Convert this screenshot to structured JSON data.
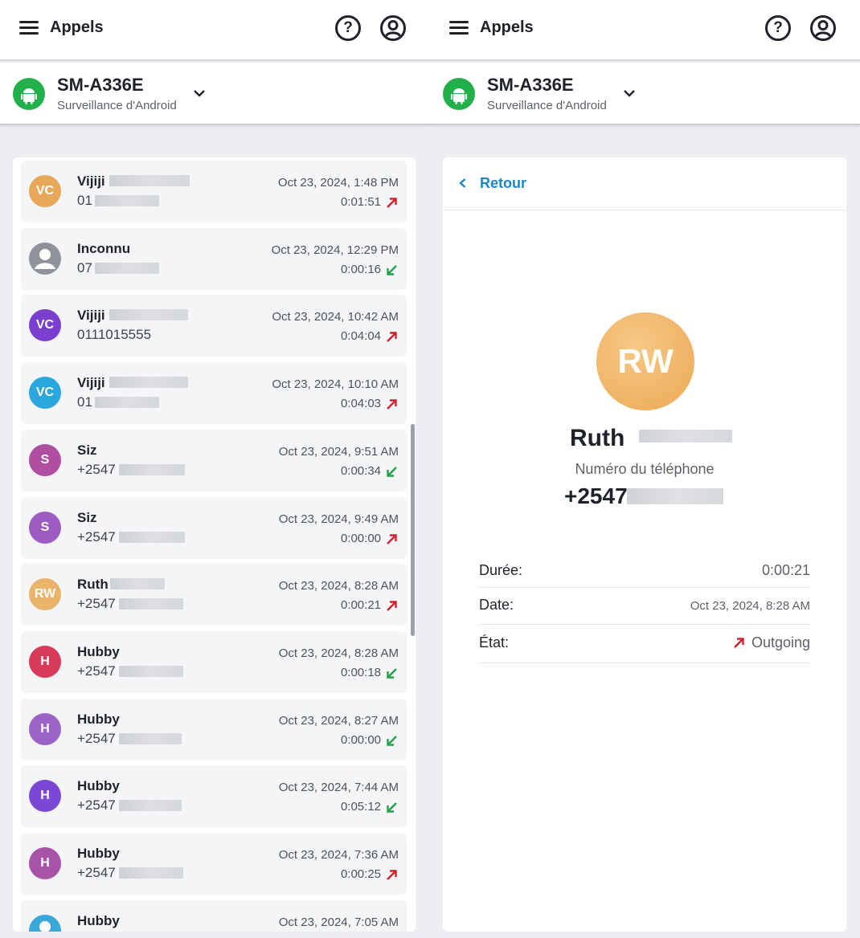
{
  "app": {
    "title": "Appels"
  },
  "device": {
    "name": "SM-A336E",
    "subtitle": "Surveillance d'Android"
  },
  "icons": {
    "menu": "hamburger-menu-icon",
    "help": "question-mark-icon",
    "account": "user-circle-icon",
    "device": "android-icon",
    "dropdown": "chevron-down-icon",
    "outgoing": "arrow-up-right-icon",
    "incoming": "arrow-down-left-icon",
    "back": "chevron-left-icon"
  },
  "colors": {
    "outgoing": "#d0202e",
    "incoming": "#22a04b",
    "link": "#1a86c7",
    "android_green": "#22b04b"
  },
  "help_glyph": "?",
  "calls": [
    {
      "initials": "VC",
      "avatar_color": "#e8a85a",
      "name": "Vijiji",
      "number": "01",
      "date": "Oct 23, 2024, 1:48 PM",
      "duration": "0:01:51",
      "direction": "outgoing"
    },
    {
      "initials": "",
      "avatar_color": "#8e939b",
      "name": "Inconnu",
      "number": "07",
      "date": "Oct 23, 2024, 12:29 PM",
      "duration": "0:00:16",
      "direction": "incoming"
    },
    {
      "initials": "VC",
      "avatar_color": "#7a3fd1",
      "name": "Vijiji",
      "number": "0111015555",
      "date": "Oct 23, 2024, 10:42 AM",
      "duration": "0:04:04",
      "direction": "outgoing"
    },
    {
      "initials": "VC",
      "avatar_color": "#2aa7dd",
      "name": "Vijiji",
      "number": "01",
      "date": "Oct 23, 2024, 10:10 AM",
      "duration": "0:04:03",
      "direction": "outgoing"
    },
    {
      "initials": "S",
      "avatar_color": "#b04fa0",
      "name": "Siz",
      "number": "+2547",
      "date": "Oct 23, 2024, 9:51 AM",
      "duration": "0:00:34",
      "direction": "incoming"
    },
    {
      "initials": "S",
      "avatar_color": "#9c5cc0",
      "name": "Siz",
      "number": "+2547",
      "date": "Oct 23, 2024, 9:49 AM",
      "duration": "0:00:00",
      "direction": "outgoing"
    },
    {
      "initials": "RW",
      "avatar_color": "#eab46a",
      "name": "Ruth",
      "number": "+2547",
      "date": "Oct 23, 2024, 8:28 AM",
      "duration": "0:00:21",
      "direction": "outgoing"
    },
    {
      "initials": "H",
      "avatar_color": "#d83a5a",
      "name": "Hubby",
      "number": "+2547",
      "date": "Oct 23, 2024, 8:28 AM",
      "duration": "0:00:18",
      "direction": "incoming"
    },
    {
      "initials": "H",
      "avatar_color": "#9a63c6",
      "name": "Hubby",
      "number": "+2547",
      "date": "Oct 23, 2024, 8:27 AM",
      "duration": "0:00:00",
      "direction": "incoming"
    },
    {
      "initials": "H",
      "avatar_color": "#7b48d6",
      "name": "Hubby",
      "number": "+2547",
      "date": "Oct 23, 2024, 7:44 AM",
      "duration": "0:05:12",
      "direction": "incoming"
    },
    {
      "initials": "H",
      "avatar_color": "#a653a8",
      "name": "Hubby",
      "number": "+2547",
      "date": "Oct 23, 2024, 7:36 AM",
      "duration": "0:00:25",
      "direction": "outgoing"
    },
    {
      "initials": "",
      "avatar_color": "#3aa8d8",
      "name": "Hubby",
      "number": "",
      "date": "Oct 23, 2024, 7:05 AM",
      "duration": "",
      "direction": ""
    }
  ],
  "detail": {
    "back_label": "Retour",
    "initials": "RW",
    "name": "Ruth",
    "phone_label": "Numéro du téléphone",
    "phone": "+2547",
    "fields": [
      {
        "label": "Durée:",
        "value": "0:00:21"
      },
      {
        "label": "Date:",
        "value": "Oct 23, 2024, 8:28 AM"
      },
      {
        "label": "État:",
        "value": "Outgoing",
        "direction": "outgoing"
      }
    ]
  }
}
